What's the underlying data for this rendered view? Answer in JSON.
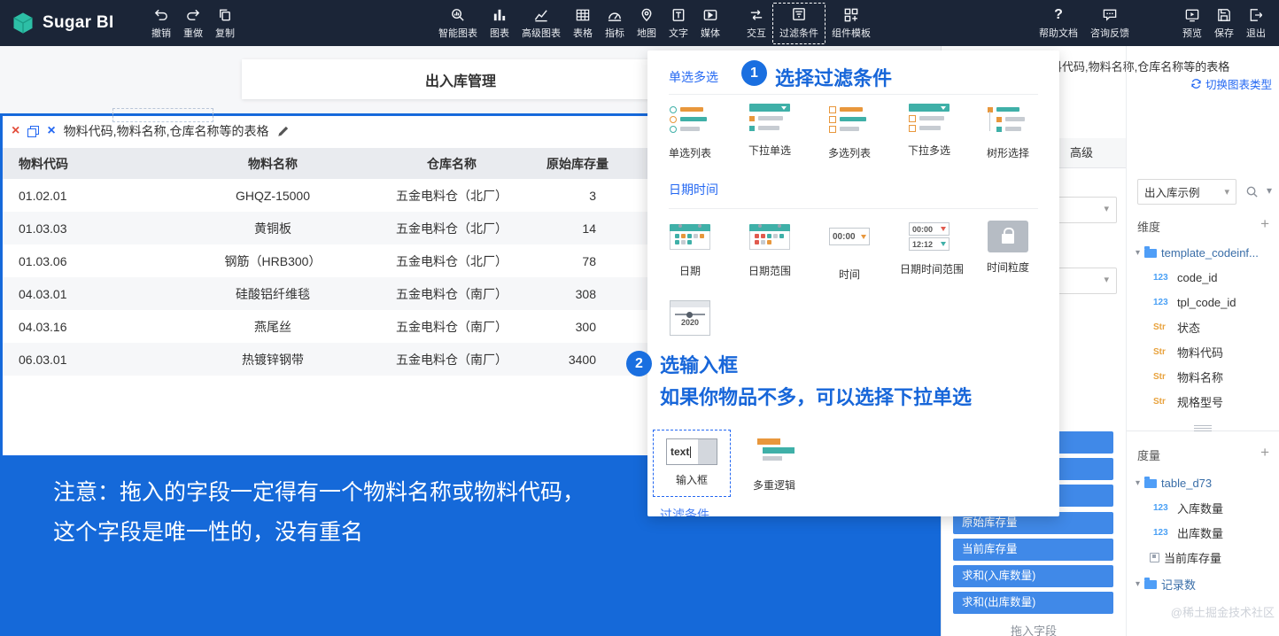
{
  "colors": {
    "accent_blue": "#2468f2",
    "canvas_blue": "#1569d9",
    "chip_blue": "#4089e8",
    "topbar_navy": "#1b2537",
    "annotation_blue": "#1766d9",
    "teal": "#3fb0a8",
    "orange": "#e8973c"
  },
  "icons": {
    "close_glyph": "×",
    "chevron_glyph": "▾",
    "plus_glyph": "+",
    "help_glyph": "?"
  },
  "topbar": {
    "brand": "Sugar BI",
    "edit_tools": [
      {
        "label": "撤销",
        "icon": "undo-icon"
      },
      {
        "label": "重做",
        "icon": "redo-icon"
      },
      {
        "label": "复制",
        "icon": "copy-icon"
      }
    ],
    "widget_tools": [
      {
        "label": "智能图表",
        "icon": "smart-chart-icon"
      },
      {
        "label": "图表",
        "icon": "chart-icon"
      },
      {
        "label": "高级图表",
        "icon": "advanced-chart-icon"
      },
      {
        "label": "表格",
        "icon": "table-icon"
      },
      {
        "label": "指标",
        "icon": "indicator-icon"
      },
      {
        "label": "地图",
        "icon": "map-icon"
      },
      {
        "label": "文字",
        "icon": "text-icon"
      },
      {
        "label": "媒体",
        "icon": "media-icon"
      },
      {
        "label": "交互",
        "icon": "interaction-icon"
      },
      {
        "label": "过滤条件",
        "icon": "filter-icon",
        "highlighted": true
      },
      {
        "label": "组件模板",
        "icon": "component-template-icon"
      }
    ],
    "help_tools": [
      {
        "label": "帮助文档",
        "icon": "help-icon"
      },
      {
        "label": "咨询反馈",
        "icon": "feedback-icon"
      }
    ],
    "action_tools": [
      {
        "label": "预览",
        "icon": "preview-icon"
      },
      {
        "label": "保存",
        "icon": "save-icon"
      },
      {
        "label": "退出",
        "icon": "exit-icon"
      }
    ]
  },
  "canvas": {
    "page_title": "出入库管理",
    "widget": {
      "title": "物料代码,物料名称,仓库名称等的表格",
      "table": {
        "columns": [
          "物料代码",
          "物料名称",
          "仓库名称",
          "原始库存量"
        ],
        "rows": [
          [
            "01.02.01",
            "GHQZ-15000",
            "五金电料仓（北厂）",
            "3"
          ],
          [
            "01.03.03",
            "黄铜板",
            "五金电料仓（北厂）",
            "14"
          ],
          [
            "01.03.06",
            "钢筋（HRB300）",
            "五金电料仓（北厂）",
            "78"
          ],
          [
            "04.03.01",
            "硅酸铝纤维毯",
            "五金电料仓（南厂）",
            "308"
          ],
          [
            "04.03.16",
            "燕尾丝",
            "五金电料仓（南厂）",
            "300"
          ],
          [
            "06.03.01",
            "热镀锌钢带",
            "五金电料仓（南厂）",
            "3400"
          ]
        ]
      }
    },
    "note_line1": "注意：拖入的字段一定得有一个物料名称或物料代码，",
    "note_line2": "这个字段是唯一性的，没有重名"
  },
  "filter_panel": {
    "section1_label": "单选多选",
    "step1": {
      "num": "1",
      "text": "选择过滤条件"
    },
    "select_items": [
      "单选列表",
      "下拉单选",
      "多选列表",
      "下拉多选",
      "树形选择"
    ],
    "section2_label": "日期时间",
    "datetime_items": [
      "日期",
      "日期范围",
      "时间",
      "日期时间范围",
      "时间粒度"
    ],
    "time_text": "00:00",
    "range_text_top": "00:00",
    "range_text_bottom": "12:12",
    "year_text": "2020",
    "step2": {
      "num": "2",
      "line1": "选输入框",
      "line2": "如果你物品不多，可以选择下拉单选"
    },
    "input_icon_text": "text",
    "input_label": "输入框",
    "logic_label": "多重逻辑",
    "clipped_label": "过滤条件"
  },
  "config_panel": {
    "tab": "高级",
    "chips": [
      "",
      "",
      "",
      "原始库存量",
      "当前库存量",
      "求和(入库数量)",
      "求和(出库数量)"
    ],
    "drag_hint": "拖入字段"
  },
  "data_panel": {
    "header_title": "物料代码,物料名称,仓库名称等的表格",
    "switch_chart_label": "切换图表类型",
    "dataset": "出入库示例",
    "dimension_label": "维度",
    "dimension_fields": [
      {
        "type": "folder",
        "label": "template_codeinf..."
      },
      {
        "type": "num",
        "prefix": "123",
        "label": "code_id"
      },
      {
        "type": "num",
        "prefix": "123",
        "label": "tpl_code_id"
      },
      {
        "type": "str",
        "prefix": "Str",
        "label": "状态"
      },
      {
        "type": "str",
        "prefix": "Str",
        "label": "物料代码"
      },
      {
        "type": "str",
        "prefix": "Str",
        "label": "物料名称"
      },
      {
        "type": "str",
        "prefix": "Str",
        "label": "规格型号"
      }
    ],
    "measure_label": "度量",
    "measure_fields": [
      {
        "type": "folder",
        "label": "table_d73"
      },
      {
        "type": "num",
        "prefix": "123",
        "label": "入库数量"
      },
      {
        "type": "num",
        "prefix": "123",
        "label": "出库数量"
      },
      {
        "type": "calc",
        "label": "当前库存量"
      },
      {
        "type": "folder",
        "label": "记录数"
      }
    ],
    "watermark": "@稀土掘金技术社区"
  }
}
